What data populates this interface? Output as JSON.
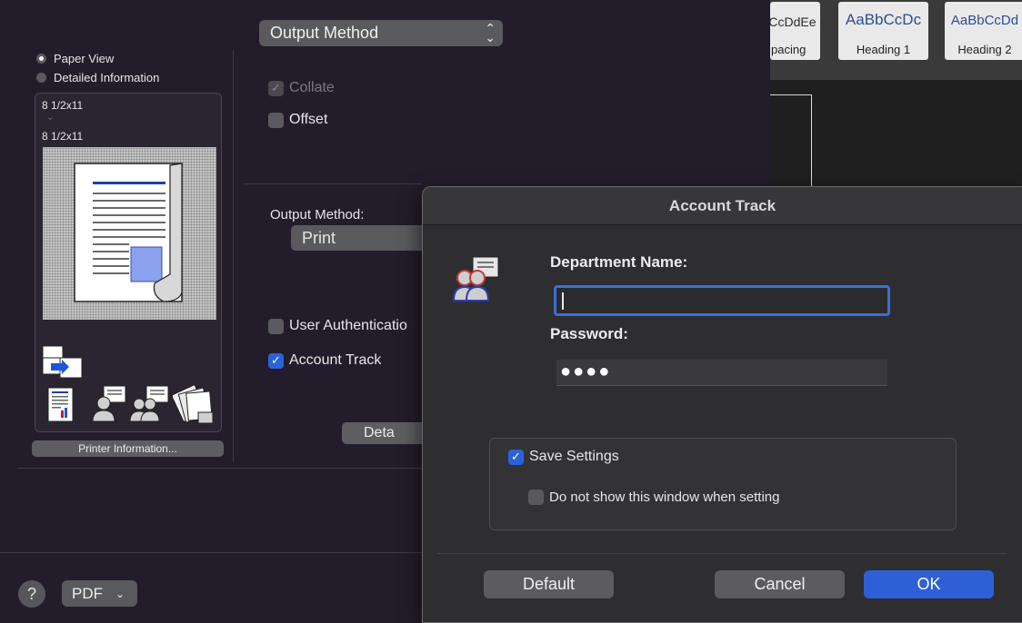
{
  "ribbon": {
    "styles": [
      {
        "sample": "CcDdEe",
        "name": "pacing"
      },
      {
        "sample": "AaBbCcDc",
        "name": "Heading 1"
      },
      {
        "sample": "AaBbCcDd",
        "name": "Heading 2"
      }
    ]
  },
  "left": {
    "view_options": [
      {
        "label": "Paper View",
        "selected": true
      },
      {
        "label": "Detailed Information",
        "selected": false
      }
    ],
    "size_from": "8 1/2x11",
    "size_to": "8 1/2x11",
    "printer_info_label": "Printer Information..."
  },
  "middle": {
    "output_select": "Output Method",
    "collate_label": "Collate",
    "offset_label": "Offset",
    "output_method_label": "Output Method:",
    "output_method_value": "Print",
    "user_auth_label": "User Authenticatio",
    "account_track_label": "Account Track",
    "details_label": "Deta"
  },
  "dialog": {
    "title": "Account Track",
    "dept_label": "Department Name:",
    "dept_value": "",
    "password_label": "Password:",
    "password_value": "●●●●",
    "save_settings_label": "Save Settings",
    "save_settings_checked": true,
    "dont_show_label": "Do not show this window when setting",
    "dont_show_checked": false,
    "default_label": "Default",
    "cancel_label": "Cancel",
    "ok_label": "OK"
  },
  "footer": {
    "help_label": "?",
    "pdf_label": "PDF"
  },
  "colors": {
    "accent": "#2f5fd6",
    "checkbox_on": "#2a63d9",
    "background": "#231d2b",
    "dialog": "#2e2e30"
  }
}
